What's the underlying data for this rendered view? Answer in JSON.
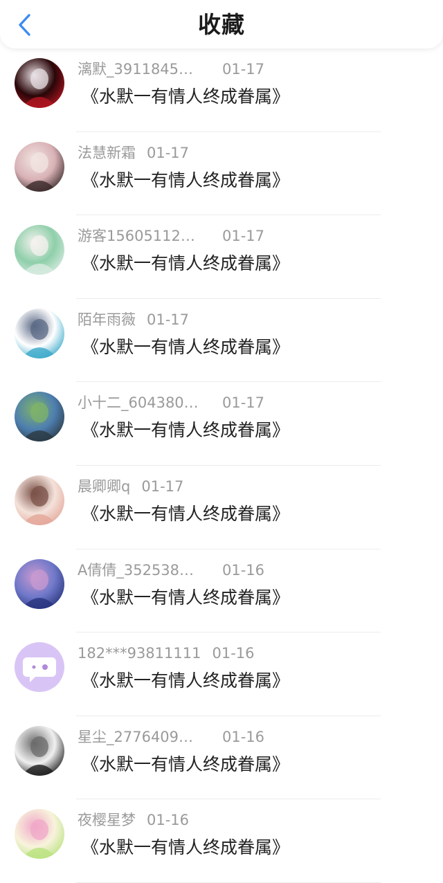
{
  "header": {
    "title": "收藏",
    "back_icon": "chevron-left-icon",
    "accent_color": "#3d8bf2"
  },
  "favorites": [
    {
      "user": "漓默_3911845…",
      "date": "01-17",
      "title": "《水默一有情人终成眷属》",
      "avatar_colors": [
        "#2a0608",
        "#b41622",
        "#e8e0e4"
      ]
    },
    {
      "user": "法慧新霜",
      "date": "01-17",
      "title": "《水默一有情人终成眷属》",
      "avatar_colors": [
        "#d9b2b6",
        "#3b2a2a",
        "#f1e4e0"
      ]
    },
    {
      "user": "游客15605112…",
      "date": "01-17",
      "title": "《水默一有情人终成眷属》",
      "avatar_colors": [
        "#8fcfaa",
        "#d8ebe1",
        "#f5f2ef"
      ]
    },
    {
      "user": "陌年雨薇",
      "date": "01-17",
      "title": "《水默一有情人终成眷属》",
      "avatar_colors": [
        "#ffffff",
        "#3aa9c9",
        "#5b6a86"
      ]
    },
    {
      "user": "小十二_604380…",
      "date": "01-17",
      "title": "《水默一有情人终成眷属》",
      "avatar_colors": [
        "#4e7fb0",
        "#2b3a44",
        "#7fb36a"
      ]
    },
    {
      "user": "晨卿卿q",
      "date": "01-17",
      "title": "《水默一有情人终成眷属》",
      "avatar_colors": [
        "#f4e2da",
        "#e4a79a",
        "#7b5148"
      ]
    },
    {
      "user": "A倩倩_352538…",
      "date": "01-16",
      "title": "《水默一有情人终成眷属》",
      "avatar_colors": [
        "#6f78c9",
        "#28357d",
        "#c99ad0"
      ]
    },
    {
      "user": "182***93811111",
      "date": "01-16",
      "title": "《水默一有情人终成眷属》",
      "avatar_colors": [
        "#d9c5f5",
        "#ffffff",
        "#b08ad8"
      ]
    },
    {
      "user": "星尘_2776409…",
      "date": "01-16",
      "title": "《水默一有情人终成眷属》",
      "avatar_colors": [
        "#f0f0f0",
        "#1b1b1b",
        "#6b6b6b"
      ]
    },
    {
      "user": "夜樱星梦",
      "date": "01-16",
      "title": "《水默一有情人终成眷属》",
      "avatar_colors": [
        "#f8f3dc",
        "#b9e27f",
        "#f0a8c8"
      ]
    }
  ]
}
